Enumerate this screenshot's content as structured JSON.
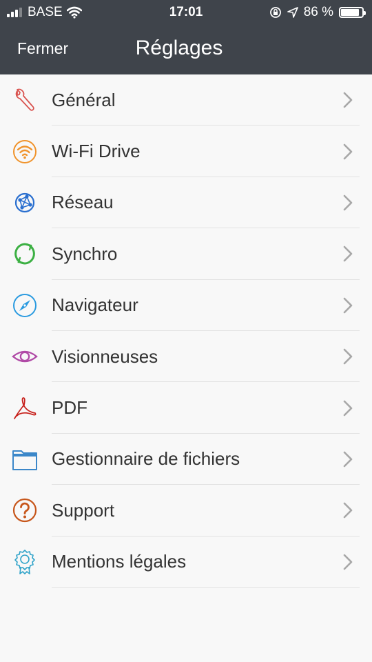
{
  "status_bar": {
    "carrier": "BASE",
    "time": "17:01",
    "battery_percent": "86 %",
    "battery_level": 0.86
  },
  "nav": {
    "close_label": "Fermer",
    "title": "Réglages"
  },
  "settings": [
    {
      "label": "Général",
      "icon": "wrench-icon",
      "color": "#d9534f"
    },
    {
      "label": "Wi-Fi Drive",
      "icon": "wifi-icon",
      "color": "#f0932b"
    },
    {
      "label": "Réseau",
      "icon": "network-icon",
      "color": "#2a6fcf"
    },
    {
      "label": "Synchro",
      "icon": "sync-icon",
      "color": "#3cb043"
    },
    {
      "label": "Navigateur",
      "icon": "compass-icon",
      "color": "#2b9be0"
    },
    {
      "label": "Visionneuses",
      "icon": "eye-icon",
      "color": "#b04aa6"
    },
    {
      "label": "PDF",
      "icon": "pdf-icon",
      "color": "#c8231e"
    },
    {
      "label": "Gestionnaire de fichiers",
      "icon": "folder-icon",
      "color": "#3b87c9"
    },
    {
      "label": "Support",
      "icon": "question-icon",
      "color": "#c7561b"
    },
    {
      "label": "Mentions légales",
      "icon": "award-icon",
      "color": "#2fa3c9"
    }
  ]
}
